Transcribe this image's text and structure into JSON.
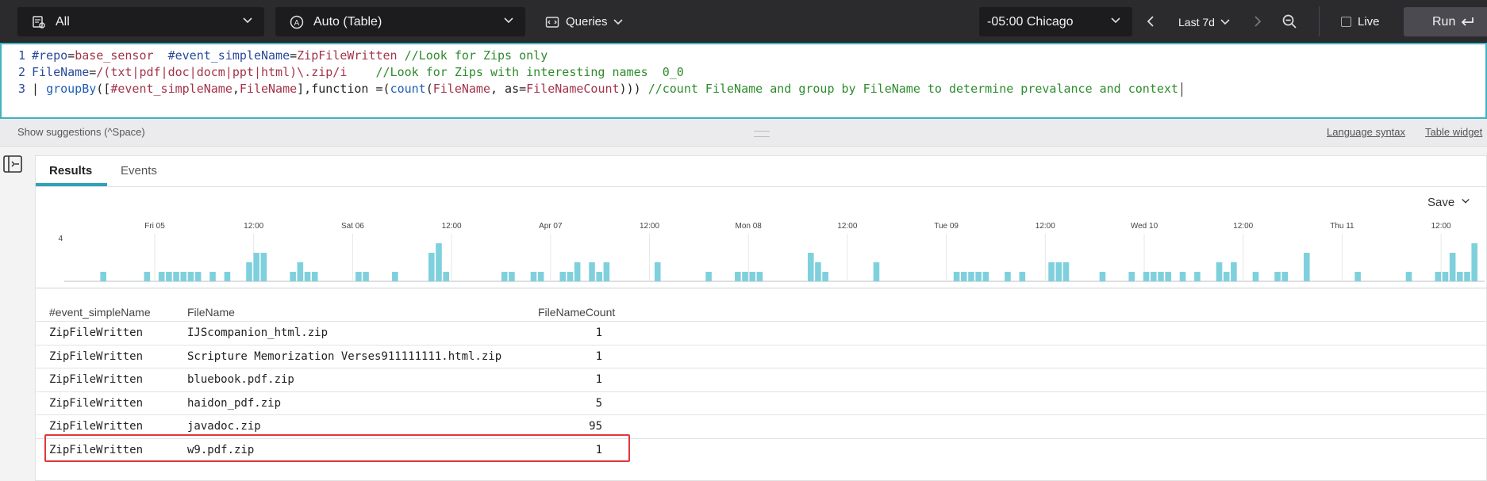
{
  "topbar": {
    "repo_select": "All",
    "widget_select": "Auto (Table)",
    "queries_label": "Queries",
    "timezone": "-05:00 Chicago",
    "time_range": "Last 7d",
    "live_label": "Live",
    "run_label": "Run"
  },
  "editor": {
    "lines": [
      {
        "num": "1",
        "parts": [
          {
            "text": "#repo",
            "cls": "tag"
          },
          {
            "text": "=",
            "cls": "pl"
          },
          {
            "text": "base_sensor",
            "cls": "str"
          },
          {
            "text": "  ",
            "cls": "pl"
          },
          {
            "text": "#event_simpleName",
            "cls": "tag"
          },
          {
            "text": "=",
            "cls": "pl"
          },
          {
            "text": "ZipFileWritten",
            "cls": "str"
          },
          {
            "text": " //Look for Zips only",
            "cls": "cm"
          }
        ]
      },
      {
        "num": "2",
        "parts": [
          {
            "text": "FileName",
            "cls": "tag"
          },
          {
            "text": "=",
            "cls": "pl"
          },
          {
            "text": "/(txt|pdf|doc|docm|ppt|html)\\.zip/i",
            "cls": "str"
          },
          {
            "text": "    //Look for Zips with interesting names  0_0",
            "cls": "cm"
          }
        ]
      },
      {
        "num": "3",
        "parts": [
          {
            "text": "| ",
            "cls": "pl"
          },
          {
            "text": "groupBy",
            "cls": "fn"
          },
          {
            "text": "([",
            "cls": "pl"
          },
          {
            "text": "#event_simpleName",
            "cls": "str"
          },
          {
            "text": ",",
            "cls": "pl"
          },
          {
            "text": "FileName",
            "cls": "str"
          },
          {
            "text": "],function =(",
            "cls": "pl"
          },
          {
            "text": "count",
            "cls": "fn"
          },
          {
            "text": "(",
            "cls": "pl"
          },
          {
            "text": "FileName",
            "cls": "str"
          },
          {
            "text": ", as=",
            "cls": "pl"
          },
          {
            "text": "FileNameCount",
            "cls": "str"
          },
          {
            "text": "))) ",
            "cls": "pl"
          },
          {
            "text": "//count FileName and group by FileName to determine prevalance and context",
            "cls": "cm"
          }
        ]
      }
    ]
  },
  "subbar": {
    "suggestions": "Show suggestions (^Space)",
    "language_syntax": "Language syntax",
    "table_widget": "Table widget"
  },
  "tabs": [
    {
      "label": "Results"
    },
    {
      "label": "Events"
    }
  ],
  "save_label": "Save",
  "histogram": {
    "y_max_label": "4",
    "x_labels": [
      "Fri 05",
      "12:00",
      "Sat 06",
      "12:00",
      "Apr 07",
      "12:00",
      "Mon 08",
      "12:00",
      "Tue 09",
      "12:00",
      "Wed 10",
      "12:00",
      "Thu 11",
      "12:00"
    ],
    "bars": [
      0,
      0,
      0,
      0,
      1,
      0,
      0,
      0,
      0,
      0,
      1,
      0,
      1,
      1,
      1,
      1,
      1,
      1,
      0,
      1,
      0,
      1,
      0,
      0,
      2,
      3,
      3,
      0,
      0,
      0,
      1,
      2,
      1,
      1,
      0,
      0,
      0,
      0,
      0,
      1,
      1,
      0,
      0,
      0,
      1,
      0,
      0,
      0,
      0,
      3,
      4,
      1,
      0,
      0,
      0,
      0,
      0,
      0,
      0,
      1,
      1,
      0,
      0,
      1,
      1,
      0,
      0,
      1,
      1,
      2,
      0,
      2,
      1,
      2,
      0,
      0,
      0,
      0,
      0,
      0,
      2,
      0,
      0,
      0,
      0,
      0,
      0,
      1,
      0,
      0,
      0,
      1,
      1,
      1,
      1,
      0,
      0,
      0,
      0,
      0,
      0,
      3,
      2,
      1,
      0,
      0,
      0,
      0,
      0,
      0,
      2,
      0,
      0,
      0,
      0,
      0,
      0,
      0,
      0,
      0,
      0,
      1,
      1,
      1,
      1,
      1,
      0,
      0,
      1,
      0,
      1,
      0,
      0,
      0,
      2,
      2,
      2,
      0,
      0,
      0,
      0,
      1,
      0,
      0,
      0,
      1,
      0,
      1,
      1,
      1,
      1,
      0,
      1,
      0,
      1,
      0,
      0,
      2,
      1,
      2,
      0,
      0,
      1,
      0,
      0,
      1,
      1,
      0,
      0,
      3,
      0,
      0,
      0,
      0,
      0,
      0,
      1,
      0,
      0,
      0,
      0,
      0,
      0,
      1,
      0,
      0,
      0,
      1,
      1,
      3,
      1,
      1,
      4
    ]
  },
  "table": {
    "columns": [
      "#event_simpleName",
      "FileName",
      "FileNameCount"
    ],
    "rows": [
      {
        "event": "ZipFileWritten",
        "file": "IJScompanion_html.zip",
        "count": "1"
      },
      {
        "event": "ZipFileWritten",
        "file": "Scripture Memorization Verses911111111.html.zip",
        "count": "1"
      },
      {
        "event": "ZipFileWritten",
        "file": "bluebook.pdf.zip",
        "count": "1"
      },
      {
        "event": "ZipFileWritten",
        "file": "haidon_pdf.zip",
        "count": "5"
      },
      {
        "event": "ZipFileWritten",
        "file": "javadoc.zip",
        "count": "95"
      },
      {
        "event": "ZipFileWritten",
        "file": "w9.pdf.zip",
        "count": "1"
      }
    ]
  },
  "colors": {
    "accent": "#2fa2b9",
    "bar": "#7fd0dd",
    "highlight": "#e0383a"
  }
}
